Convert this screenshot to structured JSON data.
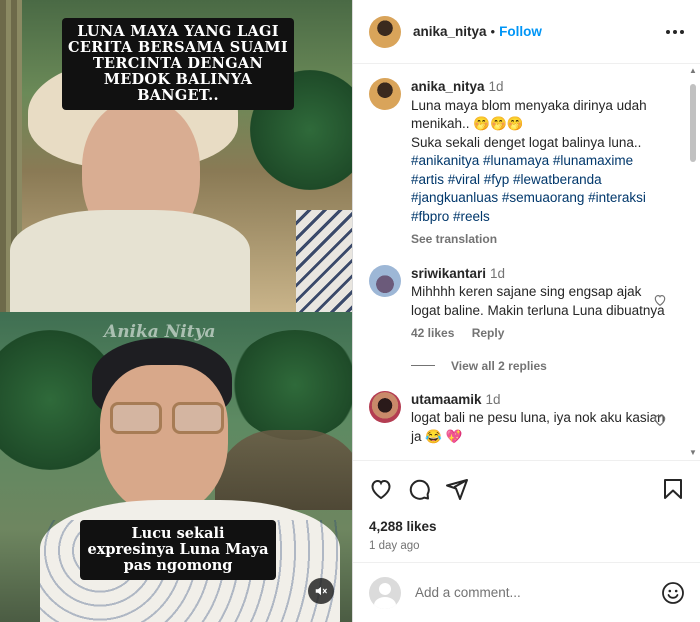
{
  "video": {
    "caption_top": "LUNA MAYA YANG LAGI CERITA BERSAMA SUAMI TERCINTA DENGAN MEDOK BALINYA  BANGET..",
    "caption_bottom": "Lucu sekali expresinya Luna Maya pas ngomong",
    "watermark": "Anika Nitya",
    "mute_icon": "speaker-muted-icon"
  },
  "header": {
    "username": "anika_nitya",
    "separator": "•",
    "follow_label": "Follow",
    "more_icon": "more-options-icon"
  },
  "post_caption": {
    "username": "anika_nitya",
    "time": "1d",
    "text_line1": "Luna maya blom menyaka dirinya udah menikah.. 🤭🤭🤭",
    "text_line2": "Suka sekali denget logat balinya luna..",
    "hashtags": "#anikanitya #lunamaya #lunamaxime #artis #viral #fyp #lewatberanda #jangkuanluas #semuaorang #interaksi #fbpro #reels",
    "see_translation": "See translation"
  },
  "comments": [
    {
      "username": "sriwikantari",
      "time": "1d",
      "text": "Mihhhh keren sajane sing engsap ajak logat baline. Makin terluna Luna dibuatnya",
      "likes": "42 likes",
      "reply": "Reply",
      "view_replies": "View all 2 replies"
    },
    {
      "username": "utamaamik",
      "time": "1d",
      "text": "logat bali ne pesu luna, iya nok aku kasian ja 😂 💖"
    }
  ],
  "actions": {
    "likes": "4,288 likes",
    "posted": "1 day ago"
  },
  "add_comment": {
    "placeholder": "Add a comment..."
  },
  "colors": {
    "follow_blue": "#0095f6",
    "hashtag": "#00376b",
    "muted_text": "#737373"
  }
}
